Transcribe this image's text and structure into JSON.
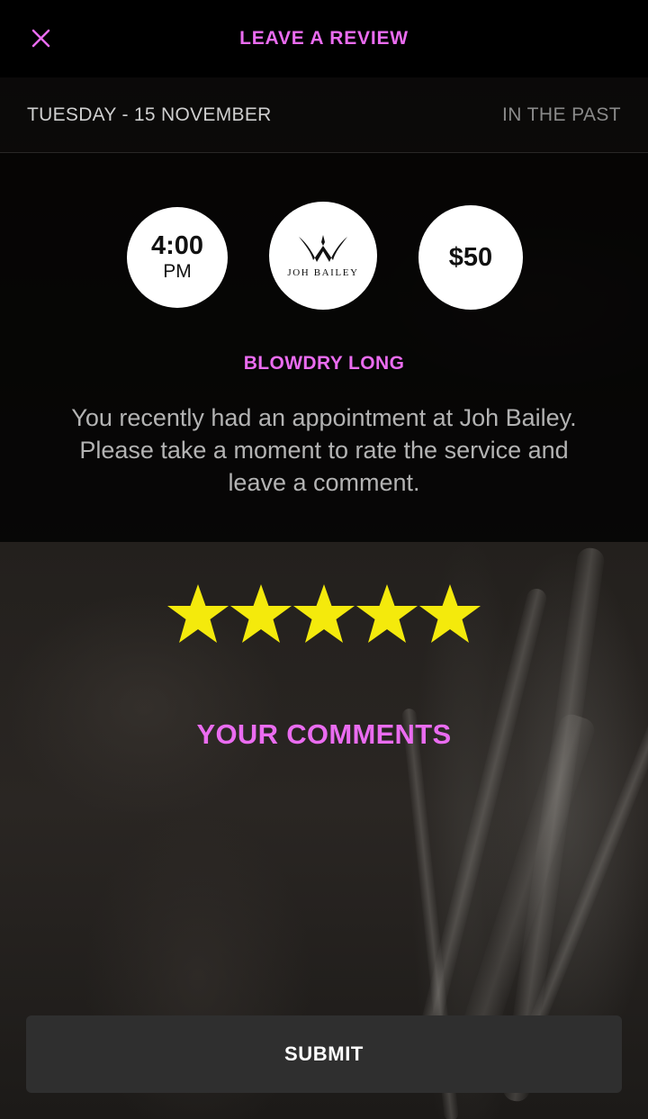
{
  "header": {
    "title": "LEAVE A REVIEW",
    "close_icon": "close-icon"
  },
  "appointment": {
    "date": "TUESDAY - 15 NOVEMBER",
    "status": "IN THE PAST",
    "time": "4:00",
    "time_period": "PM",
    "salon_logo_text": "JOH BAILEY",
    "price": "$50",
    "service": "BLOWDRY LONG"
  },
  "message": "You recently had an appointment at Joh Bailey. Please take a moment to rate the service and leave a comment.",
  "rating": {
    "value": 5,
    "max": 5,
    "star_color": "#f4ea0c"
  },
  "comments": {
    "label": "YOUR COMMENTS",
    "value": "",
    "placeholder": ""
  },
  "submit": {
    "label": "SUBMIT"
  },
  "colors": {
    "accent": "#ea6cf0",
    "button_bg": "#2f2f2f"
  }
}
